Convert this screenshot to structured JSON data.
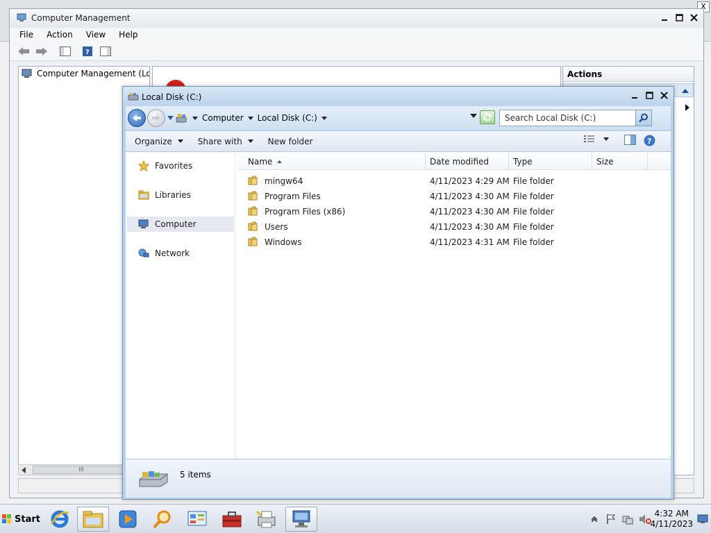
{
  "bg_window": {
    "close_glyph": "X"
  },
  "computer_management": {
    "title": "Computer Management",
    "menu": [
      "File",
      "Action",
      "View",
      "Help"
    ],
    "tree_root": "Computer Management (Local",
    "actions_header": "Actions",
    "scroll_thumb": "III"
  },
  "explorer": {
    "title": "Local Disk (C:)",
    "breadcrumb": [
      "Computer",
      "Local Disk (C:)"
    ],
    "search_placeholder": "Search Local Disk (C:)",
    "commands": {
      "organize": "Organize",
      "share_with": "Share with",
      "new_folder": "New folder"
    },
    "nav_items": [
      {
        "label": "Favorites",
        "icon": "star-icon",
        "selected": false
      },
      {
        "label": "Libraries",
        "icon": "libraries-icon",
        "selected": false
      },
      {
        "label": "Computer",
        "icon": "computer-icon",
        "selected": true
      },
      {
        "label": "Network",
        "icon": "network-icon",
        "selected": false
      }
    ],
    "columns": [
      "Name",
      "Date modified",
      "Type",
      "Size"
    ],
    "files": [
      {
        "name": "mingw64",
        "date": "4/11/2023 4:29 AM",
        "type": "File folder",
        "size": ""
      },
      {
        "name": "Program Files",
        "date": "4/11/2023 4:30 AM",
        "type": "File folder",
        "size": ""
      },
      {
        "name": "Program Files (x86)",
        "date": "4/11/2023 4:30 AM",
        "type": "File folder",
        "size": ""
      },
      {
        "name": "Users",
        "date": "4/11/2023 4:30 AM",
        "type": "File folder",
        "size": ""
      },
      {
        "name": "Windows",
        "date": "4/11/2023 4:31 AM",
        "type": "File folder",
        "size": ""
      }
    ],
    "item_count": "5 items"
  },
  "taskbar": {
    "start_label": "Start",
    "apps": [
      "internet-explorer",
      "windows-explorer",
      "media-player",
      "search",
      "control-panel",
      "toolbox",
      "printer",
      "network"
    ],
    "clock_time": "4:32 AM",
    "clock_date": "4/11/2023"
  },
  "colors": {
    "explorer_frame": "#b9d1ea",
    "selection": "#e5e9ef",
    "folder": "#e8c35a"
  }
}
